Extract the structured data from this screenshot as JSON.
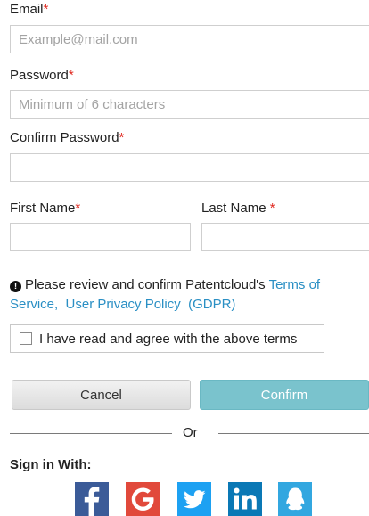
{
  "form": {
    "email": {
      "label": "Email",
      "required_mark": "*",
      "placeholder": "Example@mail.com"
    },
    "password": {
      "label": "Password",
      "required_mark": "*",
      "placeholder": "Minimum of 6 characters"
    },
    "confirm_password": {
      "label": "Confirm Password",
      "required_mark": "*",
      "placeholder": ""
    },
    "first_name": {
      "label": "First Name",
      "required_mark": "*",
      "placeholder": ""
    },
    "last_name": {
      "label": "Last Name ",
      "required_mark": "*",
      "placeholder": ""
    }
  },
  "notice": {
    "text": "Please review and confirm Patentcloud's ",
    "terms_link": "Terms of Service,",
    "privacy_link": "User Privacy Policy",
    "gdpr_link": "(GDPR)"
  },
  "agree": {
    "label": "I have read and agree with the above terms",
    "checked": false
  },
  "buttons": {
    "cancel": "Cancel",
    "confirm": "Confirm"
  },
  "divider": {
    "text": "Or"
  },
  "signin": {
    "title": "Sign in With:",
    "providers": [
      {
        "name": "facebook",
        "icon": "facebook-icon",
        "color": "#3b5b98"
      },
      {
        "name": "google",
        "icon": "google-icon",
        "color": "#e1493b"
      },
      {
        "name": "twitter",
        "icon": "twitter-icon",
        "color": "#1da1f2"
      },
      {
        "name": "linkedin",
        "icon": "linkedin-icon",
        "color": "#0a78b5"
      },
      {
        "name": "qq",
        "icon": "qq-icon",
        "color": "#32a7e0"
      }
    ]
  },
  "colors": {
    "required": "#e0281f",
    "link": "#2a8fc4",
    "confirm_button": "#7ac3cd"
  }
}
